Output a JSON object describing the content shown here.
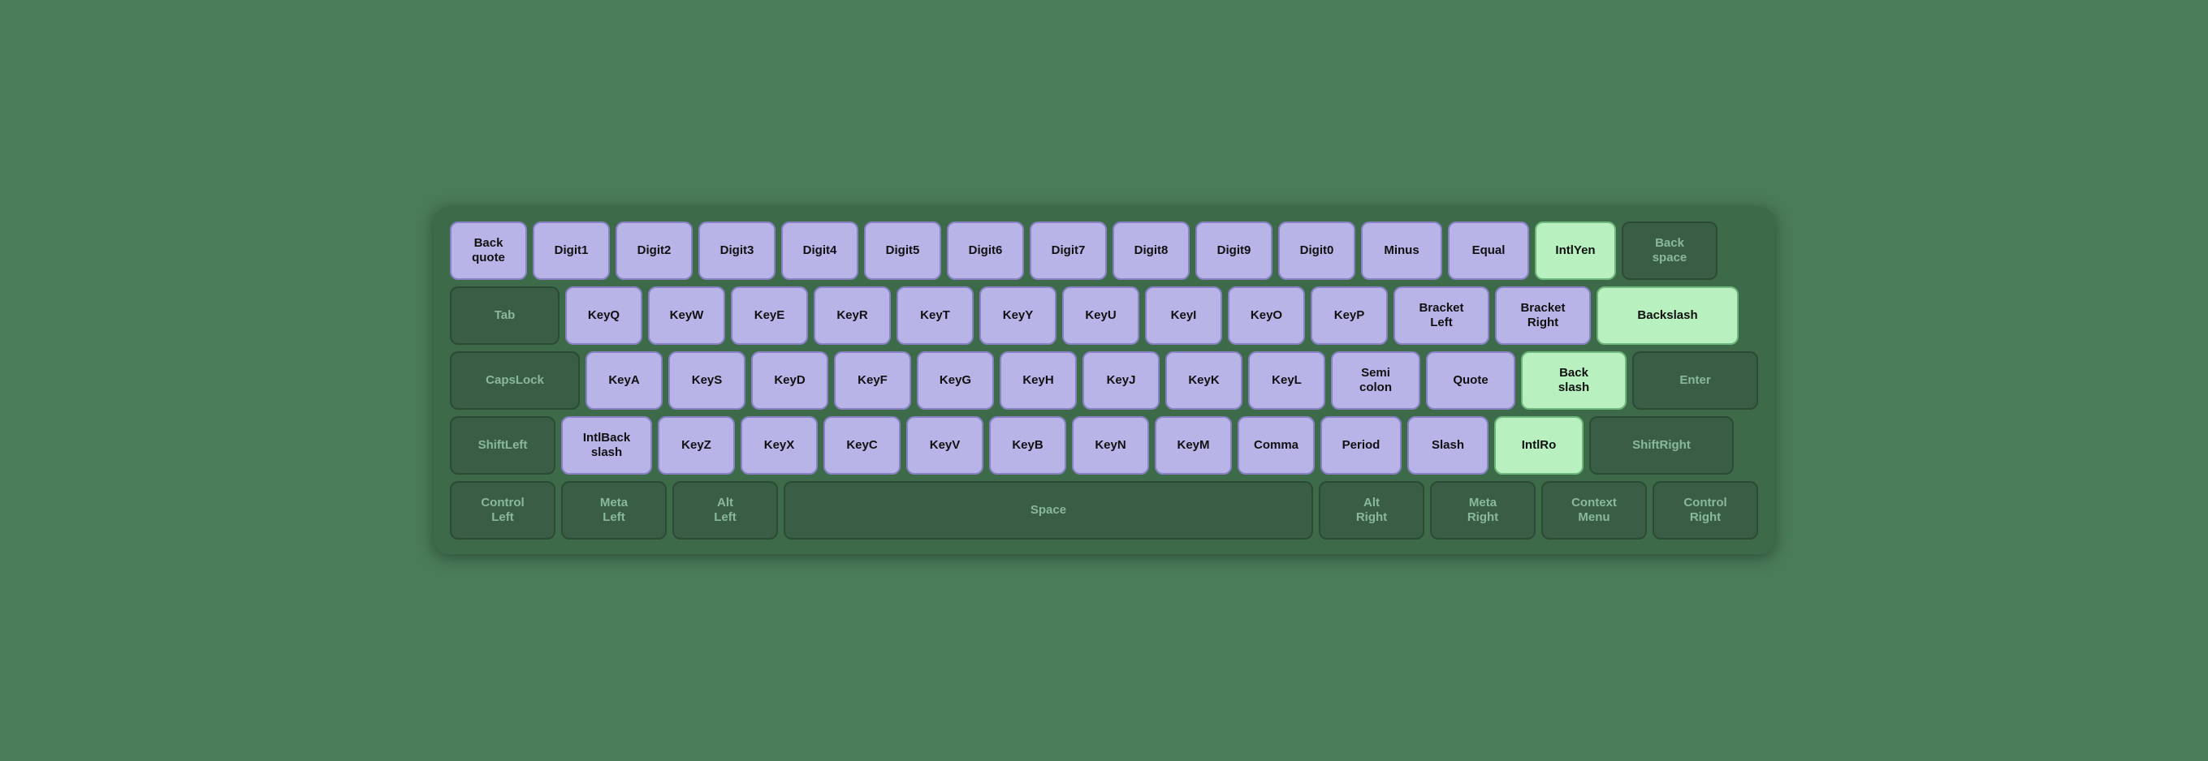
{
  "keyboard": {
    "rows": [
      {
        "id": "row1",
        "keys": [
          {
            "id": "Backquote",
            "label": "Back\nquote",
            "type": "purple",
            "width": "backquote"
          },
          {
            "id": "Digit1",
            "label": "Digit1",
            "type": "purple",
            "width": "digit"
          },
          {
            "id": "Digit2",
            "label": "Digit2",
            "type": "purple",
            "width": "digit"
          },
          {
            "id": "Digit3",
            "label": "Digit3",
            "type": "purple",
            "width": "digit"
          },
          {
            "id": "Digit4",
            "label": "Digit4",
            "type": "purple",
            "width": "digit"
          },
          {
            "id": "Digit5",
            "label": "Digit5",
            "type": "purple",
            "width": "digit"
          },
          {
            "id": "Digit6",
            "label": "Digit6",
            "type": "purple",
            "width": "digit"
          },
          {
            "id": "Digit7",
            "label": "Digit7",
            "type": "purple",
            "width": "digit"
          },
          {
            "id": "Digit8",
            "label": "Digit8",
            "type": "purple",
            "width": "digit"
          },
          {
            "id": "Digit9",
            "label": "Digit9",
            "type": "purple",
            "width": "digit"
          },
          {
            "id": "Digit0",
            "label": "Digit0",
            "type": "purple",
            "width": "digit"
          },
          {
            "id": "Minus",
            "label": "Minus",
            "type": "purple",
            "width": "minus"
          },
          {
            "id": "Equal",
            "label": "Equal",
            "type": "purple",
            "width": "equal"
          },
          {
            "id": "IntlYen",
            "label": "IntlYen",
            "type": "green",
            "width": "intlyen"
          },
          {
            "id": "Backspace",
            "label": "Back\nspace",
            "type": "dark",
            "width": "backspace"
          }
        ]
      },
      {
        "id": "row2",
        "keys": [
          {
            "id": "Tab",
            "label": "Tab",
            "type": "dark",
            "width": "tab"
          },
          {
            "id": "KeyQ",
            "label": "KeyQ",
            "type": "purple",
            "width": "key"
          },
          {
            "id": "KeyW",
            "label": "KeyW",
            "type": "purple",
            "width": "key"
          },
          {
            "id": "KeyE",
            "label": "KeyE",
            "type": "purple",
            "width": "key"
          },
          {
            "id": "KeyR",
            "label": "KeyR",
            "type": "purple",
            "width": "key"
          },
          {
            "id": "KeyT",
            "label": "KeyT",
            "type": "purple",
            "width": "key"
          },
          {
            "id": "KeyY",
            "label": "KeyY",
            "type": "purple",
            "width": "key"
          },
          {
            "id": "KeyU",
            "label": "KeyU",
            "type": "purple",
            "width": "key"
          },
          {
            "id": "KeyI",
            "label": "KeyI",
            "type": "purple",
            "width": "key"
          },
          {
            "id": "KeyO",
            "label": "KeyO",
            "type": "purple",
            "width": "key"
          },
          {
            "id": "KeyP",
            "label": "KeyP",
            "type": "purple",
            "width": "key"
          },
          {
            "id": "BracketLeft",
            "label": "Bracket\nLeft",
            "type": "purple",
            "width": "bracketleft"
          },
          {
            "id": "BracketRight",
            "label": "Bracket\nRight",
            "type": "purple",
            "width": "bracketright"
          },
          {
            "id": "Backslash",
            "label": "Backslash",
            "type": "green",
            "width": "backslash"
          }
        ]
      },
      {
        "id": "row3",
        "keys": [
          {
            "id": "CapsLock",
            "label": "CapsLock",
            "type": "dark",
            "width": "capslock"
          },
          {
            "id": "KeyA",
            "label": "KeyA",
            "type": "purple",
            "width": "key"
          },
          {
            "id": "KeyS",
            "label": "KeyS",
            "type": "purple",
            "width": "key"
          },
          {
            "id": "KeyD",
            "label": "KeyD",
            "type": "purple",
            "width": "key"
          },
          {
            "id": "KeyF",
            "label": "KeyF",
            "type": "purple",
            "width": "key"
          },
          {
            "id": "KeyG",
            "label": "KeyG",
            "type": "purple",
            "width": "key"
          },
          {
            "id": "KeyH",
            "label": "KeyH",
            "type": "purple",
            "width": "key"
          },
          {
            "id": "KeyJ",
            "label": "KeyJ",
            "type": "purple",
            "width": "key"
          },
          {
            "id": "KeyK",
            "label": "KeyK",
            "type": "purple",
            "width": "key"
          },
          {
            "id": "KeyL",
            "label": "KeyL",
            "type": "purple",
            "width": "key"
          },
          {
            "id": "Semicolon",
            "label": "Semi\ncolon",
            "type": "purple",
            "width": "semicolon"
          },
          {
            "id": "Quote",
            "label": "Quote",
            "type": "purple",
            "width": "quote"
          },
          {
            "id": "IntlBackslash2",
            "label": "Back\nslash",
            "type": "green",
            "width": "backslash2"
          },
          {
            "id": "Enter",
            "label": "Enter",
            "type": "dark",
            "width": "enter"
          }
        ]
      },
      {
        "id": "row4",
        "keys": [
          {
            "id": "ShiftLeft",
            "label": "ShiftLeft",
            "type": "dark",
            "width": "shiftleft"
          },
          {
            "id": "IntlBackslash",
            "label": "IntlBack\nslash",
            "type": "purple",
            "width": "intlback"
          },
          {
            "id": "KeyZ",
            "label": "KeyZ",
            "type": "purple",
            "width": "key"
          },
          {
            "id": "KeyX",
            "label": "KeyX",
            "type": "purple",
            "width": "key"
          },
          {
            "id": "KeyC",
            "label": "KeyC",
            "type": "purple",
            "width": "key"
          },
          {
            "id": "KeyV",
            "label": "KeyV",
            "type": "purple",
            "width": "key"
          },
          {
            "id": "KeyB",
            "label": "KeyB",
            "type": "purple",
            "width": "key"
          },
          {
            "id": "KeyN",
            "label": "KeyN",
            "type": "purple",
            "width": "key"
          },
          {
            "id": "KeyM",
            "label": "KeyM",
            "type": "purple",
            "width": "key"
          },
          {
            "id": "Comma",
            "label": "Comma",
            "type": "purple",
            "width": "key"
          },
          {
            "id": "Period",
            "label": "Period",
            "type": "purple",
            "width": "period"
          },
          {
            "id": "Slash",
            "label": "Slash",
            "type": "purple",
            "width": "slash"
          },
          {
            "id": "IntlRo",
            "label": "IntlRo",
            "type": "green",
            "width": "intlro"
          },
          {
            "id": "ShiftRight",
            "label": "ShiftRight",
            "type": "dark",
            "width": "shiftright"
          }
        ]
      },
      {
        "id": "row5",
        "keys": [
          {
            "id": "ControlLeft",
            "label": "Control\nLeft",
            "type": "dark",
            "width": "ctrlleft"
          },
          {
            "id": "MetaLeft",
            "label": "Meta\nLeft",
            "type": "dark",
            "width": "metaleft"
          },
          {
            "id": "AltLeft",
            "label": "Alt\nLeft",
            "type": "dark",
            "width": "altleft"
          },
          {
            "id": "Space",
            "label": "Space",
            "type": "dark",
            "width": "space"
          },
          {
            "id": "AltRight",
            "label": "Alt\nRight",
            "type": "dark",
            "width": "altright"
          },
          {
            "id": "MetaRight",
            "label": "Meta\nRight",
            "type": "dark",
            "width": "metaright"
          },
          {
            "id": "ContextMenu",
            "label": "Context\nMenu",
            "type": "dark",
            "width": "contextmenu"
          },
          {
            "id": "ControlRight",
            "label": "Control\nRight",
            "type": "dark",
            "width": "ctrlright"
          }
        ]
      }
    ]
  }
}
